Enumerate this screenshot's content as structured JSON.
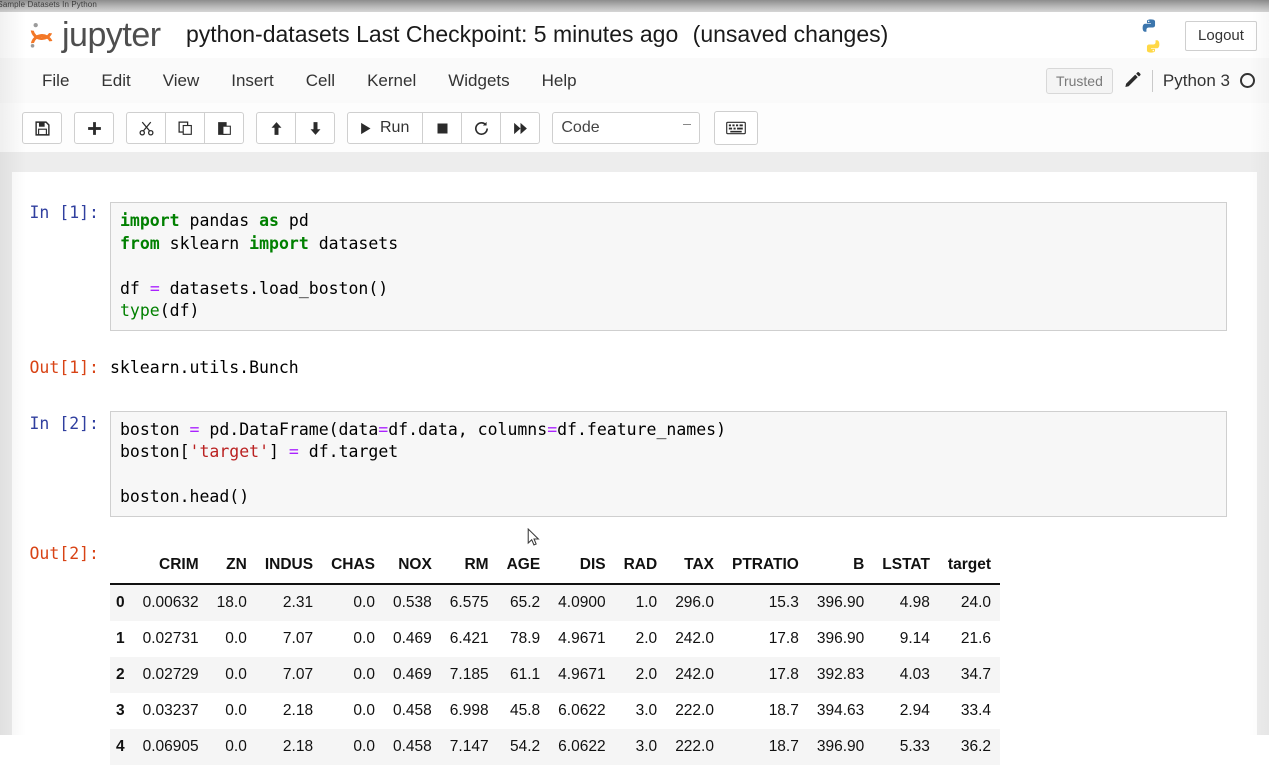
{
  "browser": {
    "tab_title": "ad Sample Datasets In Python"
  },
  "header": {
    "logo_text": "jupyter",
    "notebook_name": "python-datasets",
    "checkpoint_text": "Last Checkpoint: 5 minutes ago",
    "unsaved_text": "(unsaved changes)",
    "logout_label": "Logout",
    "python_logo_icon": "python-logo-icon"
  },
  "menubar": {
    "items": [
      {
        "label": "File"
      },
      {
        "label": "Edit"
      },
      {
        "label": "View"
      },
      {
        "label": "Insert"
      },
      {
        "label": "Cell"
      },
      {
        "label": "Kernel"
      },
      {
        "label": "Widgets"
      },
      {
        "label": "Help"
      }
    ],
    "trusted_label": "Trusted",
    "edit_icon": "pencil-icon",
    "kernel_label": "Python 3",
    "kernel_status_icon": "kernel-idle-circle-icon"
  },
  "toolbar": {
    "buttons": [
      {
        "name": "save-button",
        "icon": "floppy-disk-icon"
      },
      {
        "name": "insert-cell-below-button",
        "icon": "plus-icon"
      },
      {
        "name": "cut-cell-button",
        "icon": "scissors-icon"
      },
      {
        "name": "copy-cell-button",
        "icon": "copy-icon"
      },
      {
        "name": "paste-cell-button",
        "icon": "paste-icon"
      },
      {
        "name": "move-cell-up-button",
        "icon": "arrow-up-icon"
      },
      {
        "name": "move-cell-down-button",
        "icon": "arrow-down-icon"
      },
      {
        "name": "run-button",
        "icon": "play-icon"
      },
      {
        "name": "interrupt-kernel-button",
        "icon": "stop-square-icon"
      },
      {
        "name": "restart-kernel-button",
        "icon": "restart-circle-arrow-icon"
      },
      {
        "name": "restart-run-all-button",
        "icon": "fast-forward-icon"
      }
    ],
    "run_label": "Run",
    "cell_type_value": "Code",
    "keyboard_shortcuts_icon": "keyboard-icon"
  },
  "cells": [
    {
      "prompt": "In [1]:",
      "type": "code"
    },
    {
      "prompt": "Out[1]:",
      "type": "output_text",
      "text": "sklearn.utils.Bunch"
    },
    {
      "prompt": "In [2]:",
      "type": "code"
    },
    {
      "prompt": "Out[2]:",
      "type": "output_dataframe"
    }
  ],
  "code_cell_1": {
    "line1_kw_import": "import",
    "line1_mod": " pandas ",
    "line1_kw_as": "as",
    "line1_alias": " pd",
    "line2_kw_from": "from",
    "line2_mod": " sklearn ",
    "line2_kw_import": "import",
    "line2_name": " datasets",
    "line4_var": "df ",
    "line4_op": "=",
    "line4_call": " datasets.load_boston()",
    "line5_fn": "type",
    "line5_args": "(df)"
  },
  "code_cell_2": {
    "l1_a": "boston ",
    "l1_op": "=",
    "l1_b": " pd.DataFrame(data",
    "l1_op2": "=",
    "l1_c": "df.data, columns",
    "l1_op3": "=",
    "l1_d": "df.feature_names)",
    "l2_a": "boston[",
    "l2_str": "'target'",
    "l2_b": "] ",
    "l2_op": "=",
    "l2_c": " df.target",
    "l4": "boston.head()"
  },
  "dataframe": {
    "index_header": "",
    "columns": [
      "CRIM",
      "ZN",
      "INDUS",
      "CHAS",
      "NOX",
      "RM",
      "AGE",
      "DIS",
      "RAD",
      "TAX",
      "PTRATIO",
      "B",
      "LSTAT",
      "target"
    ],
    "index": [
      "0",
      "1",
      "2",
      "3",
      "4"
    ],
    "rows": [
      [
        "0.00632",
        "18.0",
        "2.31",
        "0.0",
        "0.538",
        "6.575",
        "65.2",
        "4.0900",
        "1.0",
        "296.0",
        "15.3",
        "396.90",
        "4.98",
        "24.0"
      ],
      [
        "0.02731",
        "0.0",
        "7.07",
        "0.0",
        "0.469",
        "6.421",
        "78.9",
        "4.9671",
        "2.0",
        "242.0",
        "17.8",
        "396.90",
        "9.14",
        "21.6"
      ],
      [
        "0.02729",
        "0.0",
        "7.07",
        "0.0",
        "0.469",
        "7.185",
        "61.1",
        "4.9671",
        "2.0",
        "242.0",
        "17.8",
        "392.83",
        "4.03",
        "34.7"
      ],
      [
        "0.03237",
        "0.0",
        "2.18",
        "0.0",
        "0.458",
        "6.998",
        "45.8",
        "6.0622",
        "3.0",
        "222.0",
        "18.7",
        "394.63",
        "2.94",
        "33.4"
      ],
      [
        "0.06905",
        "0.0",
        "2.18",
        "0.0",
        "0.458",
        "7.147",
        "54.2",
        "6.0622",
        "3.0",
        "222.0",
        "18.7",
        "396.90",
        "5.33",
        "36.2"
      ]
    ]
  },
  "colors": {
    "jupyter_orange": "#F37726",
    "in_prompt": "#303F9F",
    "out_prompt": "#D84315",
    "keyword_green": "#008000",
    "operator_purple": "#AA22FF",
    "string_red": "#BA2121"
  }
}
